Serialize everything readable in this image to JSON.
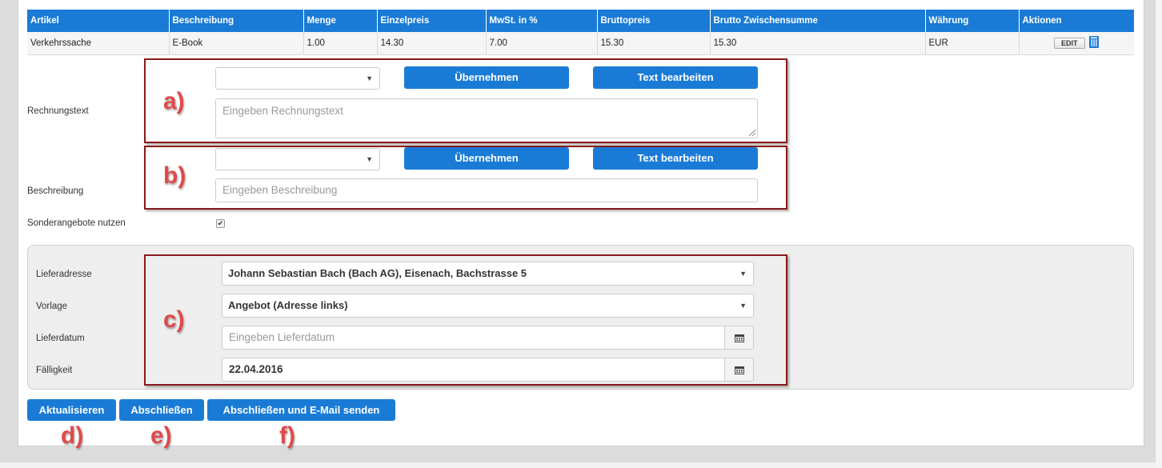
{
  "table": {
    "headers": [
      "Artikel",
      "Beschreibung",
      "Menge",
      "Einzelpreis",
      "MwSt. in %",
      "Bruttopreis",
      "Brutto Zwischensumme",
      "Währung",
      "Aktionen"
    ],
    "rows": [
      {
        "artikel": "Verkehrssache",
        "beschreibung": "E-Book",
        "menge": "1.00",
        "einzelpreis": "14.30",
        "mwst": "7.00",
        "bruttopreis": "15.30",
        "zwischensumme": "15.30",
        "waehrung": "EUR",
        "edit_label": "EDIT"
      }
    ]
  },
  "rechnungstext": {
    "label": "Rechnungstext",
    "select_value": "",
    "apply_label": "Übernehmen",
    "edit_label": "Text bearbeiten",
    "placeholder": "Eingeben Rechnungstext"
  },
  "beschreibung": {
    "label": "Beschreibung",
    "select_value": "",
    "apply_label": "Übernehmen",
    "edit_label": "Text bearbeiten",
    "placeholder": "Eingeben Beschreibung"
  },
  "sonderangebote": {
    "label": "Sonderangebote nutzen",
    "checked": true,
    "check_glyph": "✔"
  },
  "delivery": {
    "lieferadresse_label": "Lieferadresse",
    "lieferadresse_value": "Johann Sebastian Bach (Bach AG), Eisenach, Bachstrasse 5",
    "vorlage_label": "Vorlage",
    "vorlage_value": "Angebot (Adresse links)",
    "lieferdatum_label": "Lieferdatum",
    "lieferdatum_placeholder": "Eingeben Lieferdatum",
    "faelligkeit_label": "Fälligkeit",
    "faelligkeit_value": "22.04.2016"
  },
  "actions": {
    "aktualisieren": "Aktualisieren",
    "abschliessen": "Abschließen",
    "abschliessen_email": "Abschließen und E-Mail senden"
  },
  "annotations": {
    "a": "a)",
    "b": "b)",
    "c": "c)",
    "d": "d)",
    "e": "e)",
    "f": "f)"
  },
  "colors": {
    "accent": "#1a7bd6",
    "annotation_border": "#8b1a1a",
    "annotation_text": "#e04a4a"
  }
}
